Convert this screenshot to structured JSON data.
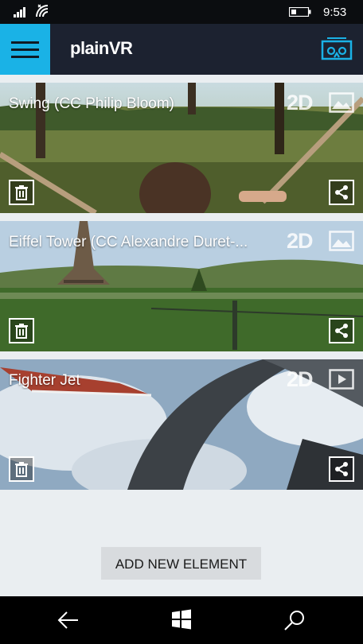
{
  "status_bar": {
    "time": "9:53",
    "icons": [
      "signal-icon",
      "wifi-icon",
      "battery-icon"
    ]
  },
  "header": {
    "title": "plainVR",
    "menu_icon": "hamburger-menu-icon",
    "vr_icon": "vr-headset-icon",
    "accent_color": "#1ab2e6"
  },
  "items": [
    {
      "title": "Swing (CC Philip Bloom)",
      "mode": "2D",
      "type_icon": "image-icon"
    },
    {
      "title": "Eiffel Tower (CC Alexandre Duret-...",
      "mode": "2D",
      "type_icon": "image-icon"
    },
    {
      "title": "Fighter Jet",
      "mode": "2D",
      "type_icon": "video-icon"
    }
  ],
  "add_button": {
    "label": "ADD NEW ELEMENT"
  },
  "nav_bar": {
    "icons": [
      "back-arrow-icon",
      "windows-start-icon",
      "search-icon"
    ]
  }
}
